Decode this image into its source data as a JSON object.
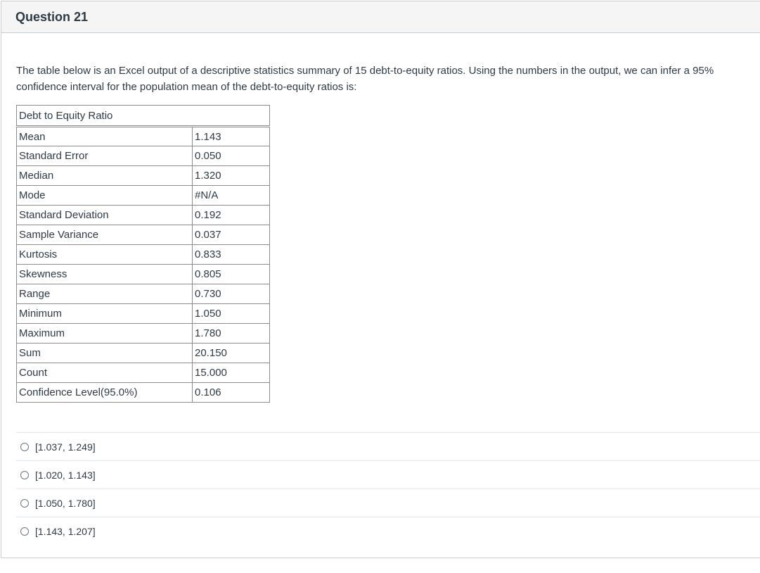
{
  "question": {
    "title": "Question 21",
    "text": "The table below is an Excel output of a descriptive statistics summary of 15 debt-to-equity ratios. Using the numbers in the output, we can infer a 95% confidence interval for the population mean of the debt-to-equity ratios is:"
  },
  "table": {
    "header": "Debt to Equity Ratio",
    "rows": [
      {
        "label": "Mean",
        "value": "1.143"
      },
      {
        "label": "Standard Error",
        "value": "0.050"
      },
      {
        "label": "Median",
        "value": "1.320"
      },
      {
        "label": "Mode",
        "value": "#N/A"
      },
      {
        "label": "Standard Deviation",
        "value": "0.192"
      },
      {
        "label": "Sample Variance",
        "value": "0.037"
      },
      {
        "label": "Kurtosis",
        "value": "0.833"
      },
      {
        "label": "Skewness",
        "value": "0.805"
      },
      {
        "label": "Range",
        "value": "0.730"
      },
      {
        "label": "Minimum",
        "value": "1.050"
      },
      {
        "label": "Maximum",
        "value": "1.780"
      },
      {
        "label": "Sum",
        "value": "20.150"
      },
      {
        "label": "Count",
        "value": "15.000"
      },
      {
        "label": "Confidence Level(95.0%)",
        "value": "0.106"
      }
    ]
  },
  "answers": [
    {
      "label": "[1.037, 1.249]",
      "selected": false
    },
    {
      "label": "[1.020, 1.143]",
      "selected": false
    },
    {
      "label": "[1.050, 1.780]",
      "selected": false
    },
    {
      "label": "[1.143, 1.207]",
      "selected": false
    }
  ],
  "colors": {
    "text": "#2d3b45",
    "border": "#c7cdd1",
    "header_bg": "#f5f5f5"
  }
}
